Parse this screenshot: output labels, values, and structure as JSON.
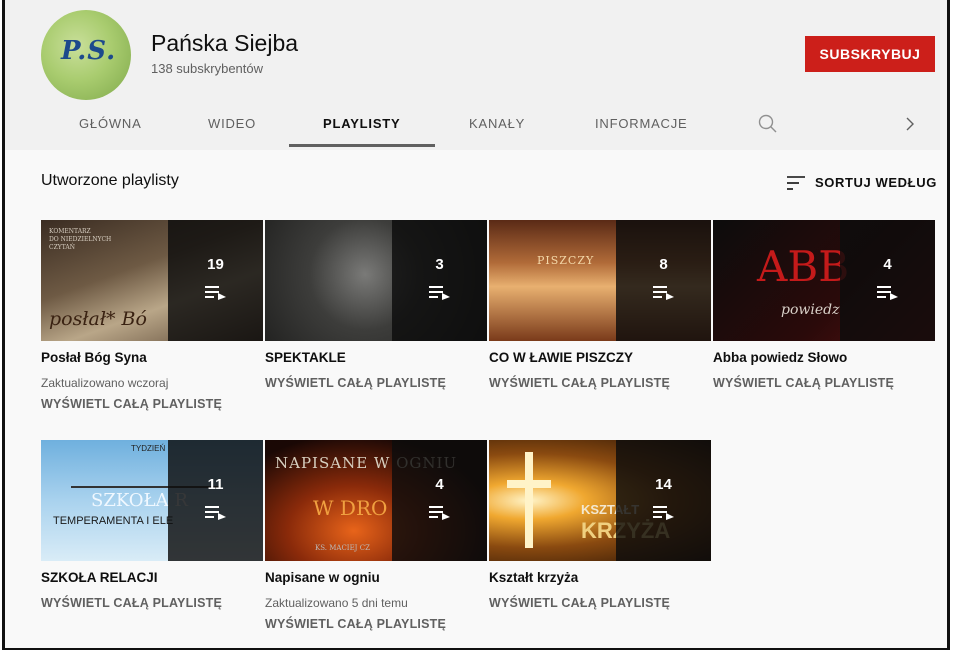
{
  "channel": {
    "name": "Pańska Siejba",
    "subscribers": "138 subskrybentów",
    "avatar_text": "P.S.",
    "subscribe_label": "SUBSKRYBUJ"
  },
  "tabs": [
    {
      "label": "GŁÓWNA"
    },
    {
      "label": "WIDEO"
    },
    {
      "label": "PLAYLISTY"
    },
    {
      "label": "KANAŁY"
    },
    {
      "label": "INFORMACJE"
    }
  ],
  "section": {
    "title": "Utworzone playlisty",
    "sort_label": "SORTUJ WEDŁUG"
  },
  "playlists": [
    {
      "title": "Posłał Bóg Syna",
      "count": "19",
      "meta": "Zaktualizowano wczoraj",
      "link": "WYŚWIETL CAŁĄ PLAYLISTĘ",
      "thumb_text": [
        "KOMENTARZ",
        "DO NIEDZIELNYCH",
        "CZYTAŃ",
        "posłał* Bó"
      ]
    },
    {
      "title": "SPEKTAKLE",
      "count": "3",
      "link": "WYŚWIETL CAŁĄ PLAYLISTĘ"
    },
    {
      "title": "CO W ŁAWIE PISZCZY",
      "count": "8",
      "link": "WYŚWIETL CAŁĄ PLAYLISTĘ",
      "thumb_text": [
        "PISZCZY"
      ]
    },
    {
      "title": "Abba powiedz Słowo",
      "count": "4",
      "link": "WYŚWIETL CAŁĄ PLAYLISTĘ",
      "thumb_text": [
        "ABB",
        "powiedz"
      ]
    },
    {
      "title": "SZKOŁA RELACJI",
      "count": "11",
      "link": "WYŚWIETL CAŁĄ PLAYLISTĘ",
      "thumb_text": [
        "TYDZIEŃ",
        "SZKOŁA R",
        "TEMPERAMENTA I ELE"
      ]
    },
    {
      "title": "Napisane w ogniu",
      "count": "4",
      "meta": "Zaktualizowano 5 dni temu",
      "link": "WYŚWIETL CAŁĄ PLAYLISTĘ",
      "thumb_text": [
        "NAPISANE W OGNIU",
        "W DRO",
        "KS. MACIEJ CZ"
      ]
    },
    {
      "title": "Kształt krzyża",
      "count": "14",
      "link": "WYŚWIETL CAŁĄ PLAYLISTĘ",
      "thumb_text": [
        "KSZTAŁT",
        "KRZYŻA"
      ]
    }
  ],
  "icons": {
    "search": "search-icon",
    "chevron": "chevron-right-icon",
    "sort": "sort-icon",
    "playlist": "playlist-play-icon"
  },
  "colors": {
    "subscribe": "#cc1f1a",
    "header_bg": "#f1f1f1",
    "page_bg": "#f9f9f9"
  }
}
